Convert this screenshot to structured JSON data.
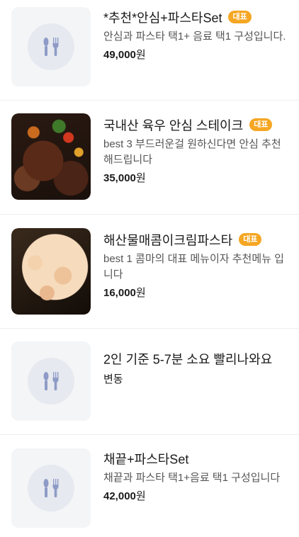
{
  "items": [
    {
      "name": "*추천*안심+파스타Set",
      "badge": "대표",
      "description": "안심과 파스타 택1+ 음료 택1 구성입니다.",
      "price": "49,000",
      "currency": "원",
      "image": "placeholder"
    },
    {
      "name": "국내산 육우 안심 스테이크",
      "badge": "대표",
      "description": "best 3 부드러운걸 원하신다면 안심 추천해드립니다",
      "price": "35,000",
      "currency": "원",
      "image": "steak-photo"
    },
    {
      "name": "해산물매콤이크림파스타",
      "badge": "대표",
      "description": "best 1 콤마의 대표 메뉴이자 추천메뉴 입니다",
      "price": "16,000",
      "currency": "원",
      "image": "pasta-photo"
    },
    {
      "name": "2인 기준 5-7분 소요 빨리나와요",
      "price_text": "변동",
      "image": "placeholder"
    },
    {
      "name": "채끝+파스타Set",
      "description": "채끝과 파스타 택1+음료 택1 구성입니다",
      "price": "42,000",
      "currency": "원",
      "image": "placeholder"
    }
  ],
  "colors": {
    "badge": "#f5a623",
    "placeholder_bg": "#f4f5f7",
    "utensil_icon": "#8e9bc7"
  },
  "icons": {
    "placeholder": "fork-knife-icon"
  }
}
